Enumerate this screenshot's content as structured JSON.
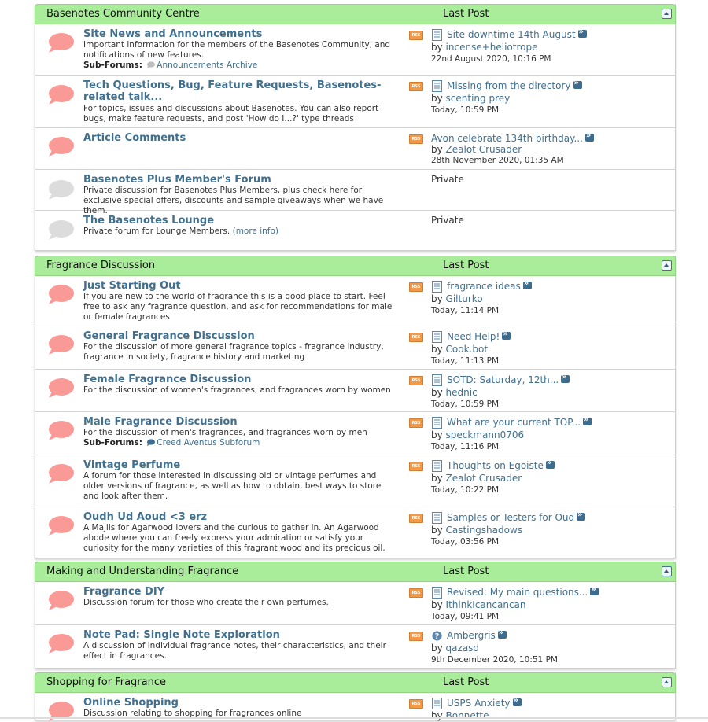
{
  "sections": [
    {
      "title": "Basenotes Community Centre",
      "last_post_label": "Last Post",
      "forums": [
        {
          "title": "Site News and Announcements",
          "desc": "Important information for the members of the Basenotes Community, and notifications of new features.",
          "subforums_label": "Sub-Forums:",
          "subforum": "Announcements Archive",
          "last_title": "Site downtime 14th August",
          "last_by": "by",
          "last_user": "incense+heliotrope",
          "last_date": "22nd August 2020, 10:16 PM"
        },
        {
          "title": "Tech Questions, Bug, Feature Requests, Basenotes-related talk...",
          "desc": "For topics, issues and discussions about Basenotes. You can also report bugs, make feature requests, and post 'How do I...?' type threads",
          "last_title": "Missing from the directory",
          "last_by": "by",
          "last_user": "scenting prey",
          "last_date": "Today, 10:59 PM"
        },
        {
          "title": "Article Comments",
          "last_title": "Avon celebrate 134th birthday...",
          "last_by": "by",
          "last_user": "Zealot Crusader",
          "last_date": "28th November 2020, 01:35 AM"
        },
        {
          "title": "Basenotes Plus Member's Forum",
          "desc": "Private discussion for Basenotes Plus Members, plus check here for exclusive special offers, discounts and sample giveaways when we have them.",
          "private": "Private"
        },
        {
          "title": "The Basenotes Lounge",
          "desc": "Private forum for Lounge Members.",
          "desc_link": "(more info)",
          "private": "Private"
        }
      ]
    },
    {
      "title": "Fragrance Discussion",
      "last_post_label": "Last Post",
      "forums": [
        {
          "title": "Just Starting Out",
          "desc": "If you are new to the world of fragrance this is a good place to start. Feel free to ask any fragrance question, and ask for recommendations for male or female fragrances",
          "last_title": "fragrance ideas",
          "last_by": "by",
          "last_user": "Gilturko",
          "last_date": "Today, 11:14 PM"
        },
        {
          "title": "General Fragrance Discussion",
          "desc": "For the discussion of more general fragrance topics - fragrance industry, fragrance in society, fragrance history and marketing",
          "last_title": "Need Help!",
          "last_by": "by",
          "last_user": "Cook.bot",
          "last_date": "Today, 11:13 PM"
        },
        {
          "title": "Female Fragrance Discussion",
          "desc": "For the discussion of women's fragrances, and fragrances worn by women",
          "last_title": "SOTD: Saturday, 12th...",
          "last_by": "by",
          "last_user": "hednic",
          "last_date": "Today, 10:59 PM"
        },
        {
          "title": "Male Fragrance Discussion",
          "desc": "For the discussion of men's fragrances, and fragrances worn by men",
          "subforums_label": "Sub-Forums:",
          "subforum": "Creed Aventus Subforum",
          "last_title": "What are your current TOP...",
          "last_by": "by",
          "last_user": "speckmann0706",
          "last_date": "Today, 11:16 PM"
        },
        {
          "title": "Vintage Perfume",
          "desc": "A forum for those interested in discussing old or vintage perfumes and older versions of fragrance, as well as how to obtain, best ways to store and look after them.",
          "last_title": "Thoughts on Egoiste",
          "last_by": "by",
          "last_user": "Zealot Crusader",
          "last_date": "Today, 10:22 PM"
        },
        {
          "title": "Oudh Ud Aoud <3 erz",
          "desc": "A Majlis for Agarwood lovers and the curious to gather in. An Agarwood abode where you can freely express your admiration or satisfy your curiosity for the many varieties of this fragrant wood and its precious oil.",
          "last_title": "Samples or Testers for Oud",
          "last_by": "by",
          "last_user": "Castingshadows",
          "last_date": "Today, 03:56 PM"
        }
      ]
    },
    {
      "title": "Making and Understanding Fragrance",
      "last_post_label": "Last Post",
      "forums": [
        {
          "title": "Fragrance DIY",
          "desc": "Discussion forum for those who create their own perfumes.",
          "last_title": "Revised: My main questions...",
          "last_by": "by",
          "last_user": "IthinkIcancancan",
          "last_date": "Today, 09:41 PM"
        },
        {
          "title": "Note Pad: Single Note Exploration",
          "desc": "A discussion of individual fragrance notes, their characteristics, and their effect in fragrances.",
          "last_title": "Ambergris",
          "last_icon": "question",
          "last_by": "by",
          "last_user": "qazasd",
          "last_date": "9th December 2020, 10:51 PM"
        }
      ]
    },
    {
      "title": "Shopping for Fragrance",
      "last_post_label": "Last Post",
      "forums": [
        {
          "title": "Online Shopping",
          "desc": "Discussion relating to shopping for fragrances online",
          "last_title": "USPS Anxiety",
          "last_by": "by",
          "last_user": "Bonnette"
        }
      ]
    }
  ],
  "rss_label": "RSS",
  "colors": {
    "header_green": "#a9ec9a",
    "link_blue": "#41708f",
    "bubble_active": "#fa9a96",
    "bubble_inactive": "#dcdcdc",
    "rss_orange": "#f09a4a"
  }
}
